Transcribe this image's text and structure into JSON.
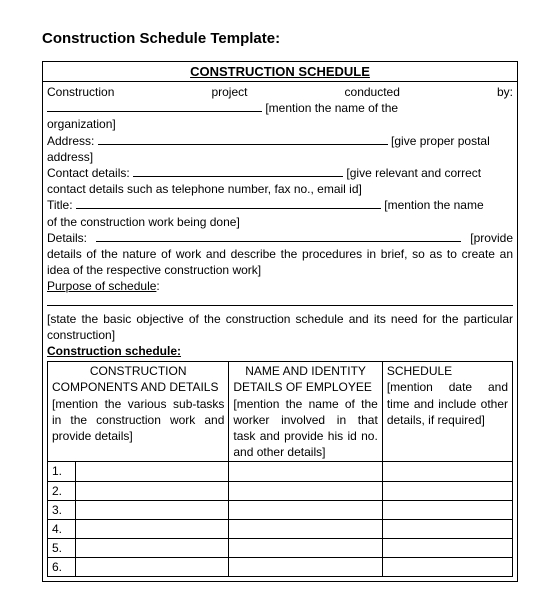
{
  "title": "Construction Schedule Template:",
  "banner": "CONSTRUCTION  SCHEDULE",
  "fields": {
    "line1_left": "Construction",
    "line1_mid": "project",
    "line1_right": "conducted",
    "line1_end": "by:",
    "line1_hint": "[mention the name of the",
    "org_line": "organization]",
    "address_label": "Address:",
    "address_hint": "[give proper postal",
    "address_line2": "address]",
    "contact_label": "Contact details:",
    "contact_hint": "[give relevant and correct",
    "contact_line2": "contact details such as telephone number, fax no., email id]",
    "title_label": "Title:",
    "title_hint": "[mention the name",
    "title_line2": "of the construction work being done]",
    "details_label": "Details:",
    "details_hint": "[provide",
    "details_line2": "details of the nature of work and describe the procedures in brief, so as to create an idea of the respective construction work]",
    "purpose_label": "Purpose of schedule",
    "purpose_colon": ":",
    "purpose_hint": "[state the basic objective of the construction schedule and its need for the particular construction]",
    "schedule_label": "Construction schedule:"
  },
  "table": {
    "col1_head": "CONSTRUCTION COMPONENTS AND DETAILS",
    "col1_hint": "[mention the various sub-tasks in the construction work and provide details]",
    "col2_head": "NAME AND IDENTITY DETAILS OF EMPLOYEE",
    "col2_hint": "[mention the name of the worker involved in that task and provide his id no. and other details]",
    "col3_head": "SCHEDULE",
    "col3_hint": "[mention date and time and include other details, if required]",
    "rows": [
      "1.",
      "2.",
      "3.",
      "4.",
      "5.",
      "6."
    ]
  }
}
